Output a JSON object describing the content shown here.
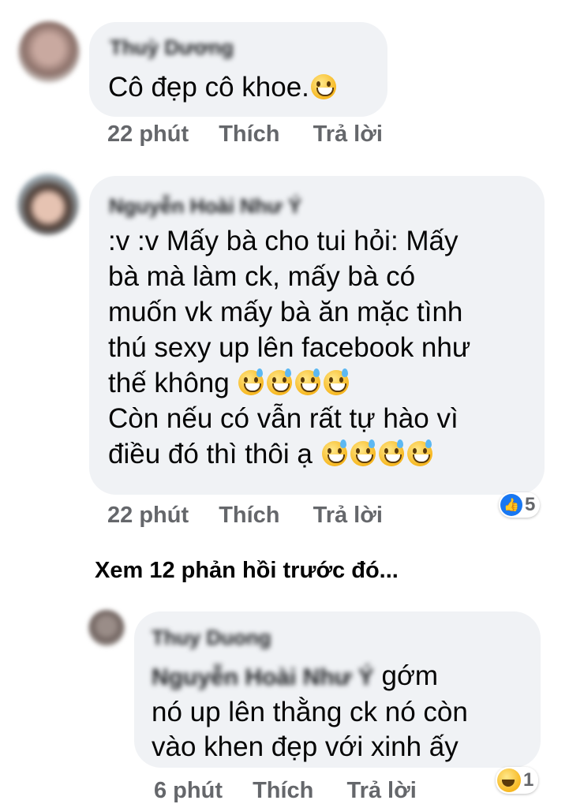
{
  "comments": [
    {
      "author": "Thuỳ Dương",
      "lines": [
        "Cô đẹp cô khoe."
      ],
      "time": "22 phút",
      "like": "Thích",
      "reply": "Trả lời"
    },
    {
      "author": "Nguyễn Hoài Như Ý",
      "lines": [
        ":v :v Mấy bà cho tui hỏi: Mấy",
        "bà mà làm ck, mấy bà có",
        "muốn vk mấy bà ăn mặc tình",
        "thú sexy up lên facebook như",
        "thế không",
        "Còn nếu có vẫn rất tự hào vì",
        "điều đó thì thôi ạ"
      ],
      "time": "22 phút",
      "like": "Thích",
      "reply": "Trả lời",
      "reaction_count": "5",
      "reaction_type": "like-icon"
    }
  ],
  "view_more": "Xem 12 phản hồi trước đó...",
  "reply": {
    "author": "Thuy Duong",
    "mention": "Nguyễn Hoài Như Ý",
    "lines": [
      "gớm",
      "nó up lên thằng ck nó còn",
      "vào khen đẹp với xinh ấy"
    ],
    "time": "6 phút",
    "like": "Thích",
    "reply": "Trả lời",
    "reaction_count": "1",
    "reaction_type": "haha-icon"
  },
  "colors": {
    "bubble": "#f0f2f5",
    "meta": "#65676b",
    "like_blue": "#1877f2"
  }
}
